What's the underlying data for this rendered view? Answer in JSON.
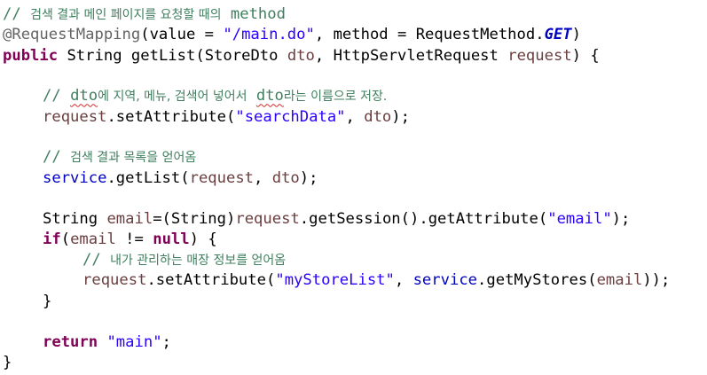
{
  "code": {
    "comment1_slashes": "//",
    "comment1_text": "검색 결과 메인 페이지를 요청할 때의",
    "comment1_method": "method",
    "annotation": "@RequestMapping",
    "value_key": "value",
    "value_string": "\"/main.do\"",
    "method_key": "method",
    "request_method_class": "RequestMethod",
    "request_method_get": "GET",
    "kw_public": "public",
    "return_type": "String",
    "method_name": "getList",
    "param1_type": "StoreDto",
    "param1_name": "dto",
    "param2_type": "HttpServletRequest",
    "param2_name": "request",
    "comment2_slashes": "//",
    "comment2_dto1": "dto",
    "comment2_text1": "에 지역, 메뉴, 검색어 넣어서",
    "comment2_dto2": "dto",
    "comment2_text2": "라는 이름으로 저장.",
    "request_var": "request",
    "set_attribute": "setAttribute",
    "search_data_string": "\"searchData\"",
    "dto_var": "dto",
    "comment3_slashes": "//",
    "comment3_text": "검색 결과 목록을 얻어옴",
    "service_field": "service",
    "get_list": "getList",
    "string_type": "String",
    "email_var": "email",
    "get_session": "getSession",
    "get_attribute": "getAttribute",
    "email_string": "\"email\"",
    "kw_if": "if",
    "kw_null": "null",
    "comment4_slashes": "//",
    "comment4_text": "내가 관리하는 매장 정보를 얻어옴",
    "my_store_list_string": "\"myStoreList\"",
    "get_my_stores": "getMyStores",
    "kw_return": "return",
    "main_string": "\"main\""
  }
}
